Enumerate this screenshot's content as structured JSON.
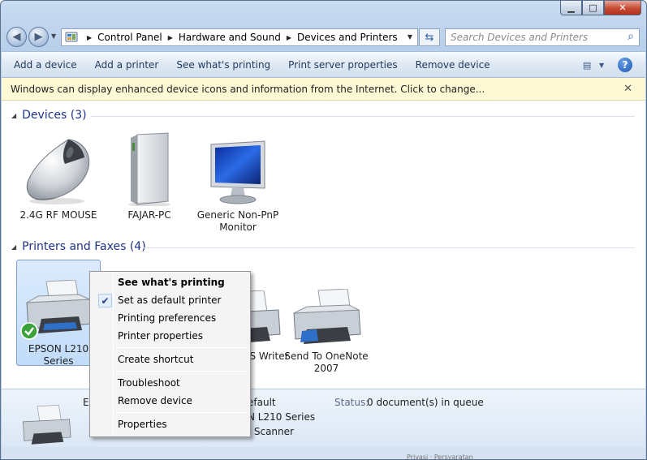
{
  "window": {
    "caption": {
      "minimize": "▁",
      "maximize": "□",
      "close": "✕"
    }
  },
  "nav": {
    "back_glyph": "◀",
    "forward_glyph": "▶",
    "recent_glyph": "▼",
    "breadcrumbs": [
      "Control Panel",
      "Hardware and Sound",
      "Devices and Printers"
    ],
    "crumb_separator": "▶",
    "dropdown_glyph": "▼",
    "refresh_glyph": "⇆"
  },
  "search": {
    "placeholder": "Search Devices and Printers",
    "icon": "⌕"
  },
  "toolbar": {
    "items": [
      "Add a device",
      "Add a printer",
      "See what's printing",
      "Print server properties",
      "Remove device"
    ],
    "view_glyph": "▤",
    "view_drop": "▼",
    "help": "?"
  },
  "infobar": {
    "message": "Windows can display enhanced device icons and information from the Internet. Click to change...",
    "close": "✕"
  },
  "groups": {
    "devices": {
      "title": "Devices (3)",
      "collapse_glyph": "◢",
      "items": [
        {
          "label": "2.4G RF MOUSE",
          "icon": "mouse-icon"
        },
        {
          "label": "FAJAR-PC",
          "icon": "computer-tower-icon"
        },
        {
          "label": "Generic Non-PnP Monitor",
          "icon": "monitor-icon"
        }
      ]
    },
    "printers": {
      "title": "Printers and Faxes (4)",
      "collapse_glyph": "◢",
      "items": [
        {
          "label": "EPSON L210 Series",
          "icon": "printer-icon",
          "default": true
        },
        {
          "label": "XPS Writer",
          "icon": "printer-icon"
        },
        {
          "label": "Send To OneNote 2007",
          "icon": "printer-icon"
        }
      ]
    }
  },
  "details": {
    "partial_name": "E",
    "state": "efault",
    "model": "N L210 Series",
    "category": "; Scanner",
    "status_label": "Status:",
    "status_value": "0 document(s) in queue"
  },
  "context_menu": {
    "items": [
      {
        "label": "See what's printing",
        "bold": true
      },
      {
        "label": "Set as default printer",
        "checked": true
      },
      {
        "label": "Printing preferences"
      },
      {
        "label": "Printer properties"
      },
      {
        "label": "Create shortcut"
      },
      {
        "label": "Troubleshoot"
      },
      {
        "label": "Remove device"
      },
      {
        "label": "Properties"
      }
    ],
    "check_glyph": "✔"
  },
  "statusbar": {
    "ghost_text": "Privasi · Persyaratan"
  },
  "colors": {
    "accent": "#1e3287",
    "selection": "#c1dcfa",
    "infobar": "#fdf9d4"
  }
}
